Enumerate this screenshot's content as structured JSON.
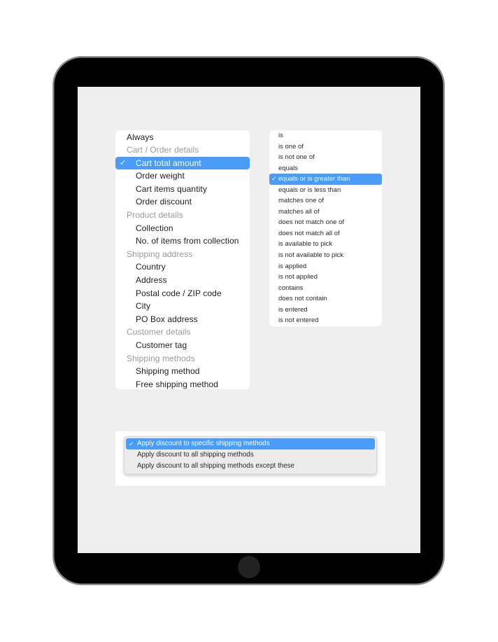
{
  "condition_menu": {
    "items": [
      {
        "type": "top",
        "label": "Always"
      },
      {
        "type": "group",
        "label": "Cart / Order details"
      },
      {
        "type": "item",
        "label": "Cart total amount",
        "selected": true
      },
      {
        "type": "item",
        "label": "Order weight"
      },
      {
        "type": "item",
        "label": "Cart items quantity"
      },
      {
        "type": "item",
        "label": "Order discount"
      },
      {
        "type": "group",
        "label": "Product details"
      },
      {
        "type": "item",
        "label": "Collection"
      },
      {
        "type": "item",
        "label": "No. of items from collection"
      },
      {
        "type": "group",
        "label": "Shipping address"
      },
      {
        "type": "item",
        "label": "Country"
      },
      {
        "type": "item",
        "label": "Address"
      },
      {
        "type": "item",
        "label": "Postal code / ZIP code"
      },
      {
        "type": "item",
        "label": "City"
      },
      {
        "type": "item",
        "label": "PO Box address"
      },
      {
        "type": "group",
        "label": "Customer details"
      },
      {
        "type": "item",
        "label": "Customer tag"
      },
      {
        "type": "group",
        "label": "Shipping methods"
      },
      {
        "type": "item",
        "label": "Shipping method"
      },
      {
        "type": "item",
        "label": "Free shipping method"
      }
    ]
  },
  "operator_menu": {
    "items": [
      {
        "label": "is"
      },
      {
        "label": "is one of"
      },
      {
        "label": "is not one of"
      },
      {
        "label": "equals"
      },
      {
        "label": "equals or is greater than",
        "selected": true
      },
      {
        "label": "equals or is less than"
      },
      {
        "label": "matches one of"
      },
      {
        "label": "matches all of"
      },
      {
        "label": "does not match one of"
      },
      {
        "label": "does not match all of"
      },
      {
        "label": "is available to pick"
      },
      {
        "label": "is not available to pick"
      },
      {
        "label": "is applied"
      },
      {
        "label": "is not applied"
      },
      {
        "label": "contains"
      },
      {
        "label": "does not contain"
      },
      {
        "label": "is entered"
      },
      {
        "label": "is not entered"
      }
    ]
  },
  "discount_dropdown": {
    "options": [
      {
        "label": "Apply discount to specific shipping methods",
        "selected": true
      },
      {
        "label": "Apply discount to all shipping methods"
      },
      {
        "label": "Apply discount to all shipping methods except these"
      }
    ]
  },
  "icons": {
    "check": "✓"
  },
  "colors": {
    "accent": "#4a9cf6",
    "screen_bg": "#efefef",
    "group_label": "#9a9a9a"
  }
}
